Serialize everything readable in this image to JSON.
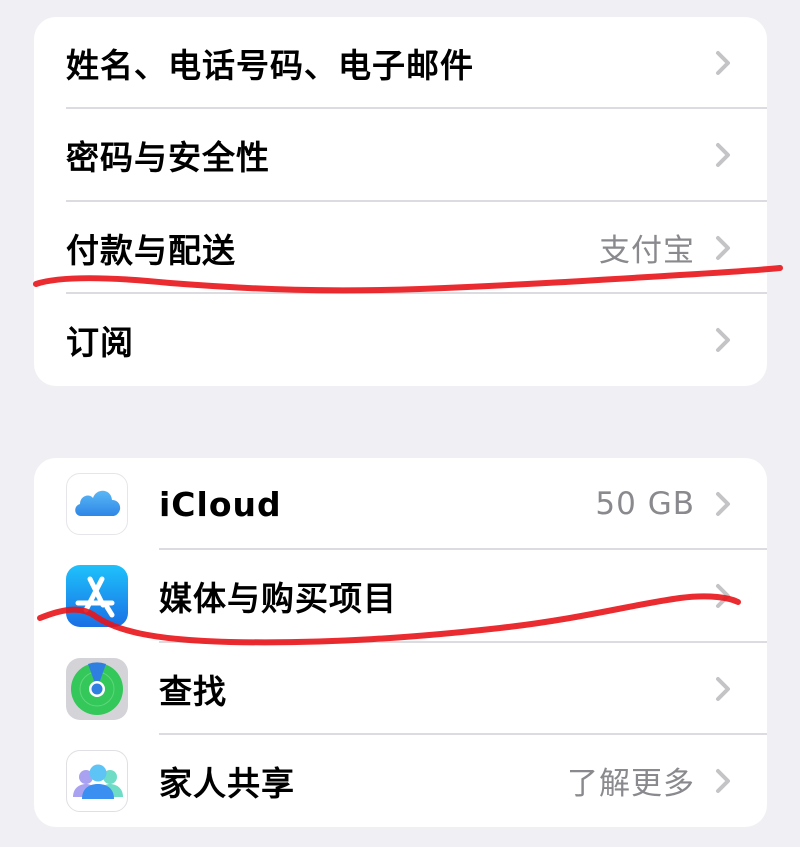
{
  "groups": [
    {
      "rows": [
        {
          "label": "姓名、电话号码、电子邮件",
          "detail": ""
        },
        {
          "label": "密码与安全性",
          "detail": ""
        },
        {
          "label": "付款与配送",
          "detail": "支付宝"
        },
        {
          "label": "订阅",
          "detail": ""
        }
      ]
    },
    {
      "rows": [
        {
          "label": "iCloud",
          "detail": "50 GB",
          "icon": "icloud-icon"
        },
        {
          "label": "媒体与购买项目",
          "detail": "",
          "icon": "app-store-icon"
        },
        {
          "label": "查找",
          "detail": "",
          "icon": "find-my-icon"
        },
        {
          "label": "家人共享",
          "detail": "了解更多",
          "icon": "family-sharing-icon"
        }
      ]
    }
  ],
  "colors": {
    "background": "#efeff4",
    "card": "#ffffff",
    "detail_text": "#8a8a8e",
    "chevron": "#c4c4c7",
    "annotation_red": "#e8141a"
  }
}
